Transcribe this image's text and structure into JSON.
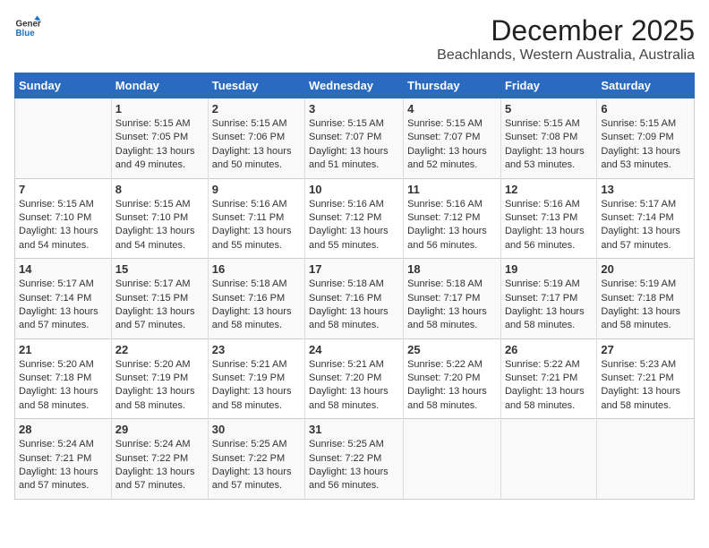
{
  "logo": {
    "general": "General",
    "blue": "Blue"
  },
  "header": {
    "title": "December 2025",
    "subtitle": "Beachlands, Western Australia, Australia"
  },
  "days_of_week": [
    "Sunday",
    "Monday",
    "Tuesday",
    "Wednesday",
    "Thursday",
    "Friday",
    "Saturday"
  ],
  "weeks": [
    [
      {
        "day": "",
        "content": ""
      },
      {
        "day": "1",
        "content": "Sunrise: 5:15 AM\nSunset: 7:05 PM\nDaylight: 13 hours\nand 49 minutes."
      },
      {
        "day": "2",
        "content": "Sunrise: 5:15 AM\nSunset: 7:06 PM\nDaylight: 13 hours\nand 50 minutes."
      },
      {
        "day": "3",
        "content": "Sunrise: 5:15 AM\nSunset: 7:07 PM\nDaylight: 13 hours\nand 51 minutes."
      },
      {
        "day": "4",
        "content": "Sunrise: 5:15 AM\nSunset: 7:07 PM\nDaylight: 13 hours\nand 52 minutes."
      },
      {
        "day": "5",
        "content": "Sunrise: 5:15 AM\nSunset: 7:08 PM\nDaylight: 13 hours\nand 53 minutes."
      },
      {
        "day": "6",
        "content": "Sunrise: 5:15 AM\nSunset: 7:09 PM\nDaylight: 13 hours\nand 53 minutes."
      }
    ],
    [
      {
        "day": "7",
        "content": "Sunrise: 5:15 AM\nSunset: 7:10 PM\nDaylight: 13 hours\nand 54 minutes."
      },
      {
        "day": "8",
        "content": "Sunrise: 5:15 AM\nSunset: 7:10 PM\nDaylight: 13 hours\nand 54 minutes."
      },
      {
        "day": "9",
        "content": "Sunrise: 5:16 AM\nSunset: 7:11 PM\nDaylight: 13 hours\nand 55 minutes."
      },
      {
        "day": "10",
        "content": "Sunrise: 5:16 AM\nSunset: 7:12 PM\nDaylight: 13 hours\nand 55 minutes."
      },
      {
        "day": "11",
        "content": "Sunrise: 5:16 AM\nSunset: 7:12 PM\nDaylight: 13 hours\nand 56 minutes."
      },
      {
        "day": "12",
        "content": "Sunrise: 5:16 AM\nSunset: 7:13 PM\nDaylight: 13 hours\nand 56 minutes."
      },
      {
        "day": "13",
        "content": "Sunrise: 5:17 AM\nSunset: 7:14 PM\nDaylight: 13 hours\nand 57 minutes."
      }
    ],
    [
      {
        "day": "14",
        "content": "Sunrise: 5:17 AM\nSunset: 7:14 PM\nDaylight: 13 hours\nand 57 minutes."
      },
      {
        "day": "15",
        "content": "Sunrise: 5:17 AM\nSunset: 7:15 PM\nDaylight: 13 hours\nand 57 minutes."
      },
      {
        "day": "16",
        "content": "Sunrise: 5:18 AM\nSunset: 7:16 PM\nDaylight: 13 hours\nand 58 minutes."
      },
      {
        "day": "17",
        "content": "Sunrise: 5:18 AM\nSunset: 7:16 PM\nDaylight: 13 hours\nand 58 minutes."
      },
      {
        "day": "18",
        "content": "Sunrise: 5:18 AM\nSunset: 7:17 PM\nDaylight: 13 hours\nand 58 minutes."
      },
      {
        "day": "19",
        "content": "Sunrise: 5:19 AM\nSunset: 7:17 PM\nDaylight: 13 hours\nand 58 minutes."
      },
      {
        "day": "20",
        "content": "Sunrise: 5:19 AM\nSunset: 7:18 PM\nDaylight: 13 hours\nand 58 minutes."
      }
    ],
    [
      {
        "day": "21",
        "content": "Sunrise: 5:20 AM\nSunset: 7:18 PM\nDaylight: 13 hours\nand 58 minutes."
      },
      {
        "day": "22",
        "content": "Sunrise: 5:20 AM\nSunset: 7:19 PM\nDaylight: 13 hours\nand 58 minutes."
      },
      {
        "day": "23",
        "content": "Sunrise: 5:21 AM\nSunset: 7:19 PM\nDaylight: 13 hours\nand 58 minutes."
      },
      {
        "day": "24",
        "content": "Sunrise: 5:21 AM\nSunset: 7:20 PM\nDaylight: 13 hours\nand 58 minutes."
      },
      {
        "day": "25",
        "content": "Sunrise: 5:22 AM\nSunset: 7:20 PM\nDaylight: 13 hours\nand 58 minutes."
      },
      {
        "day": "26",
        "content": "Sunrise: 5:22 AM\nSunset: 7:21 PM\nDaylight: 13 hours\nand 58 minutes."
      },
      {
        "day": "27",
        "content": "Sunrise: 5:23 AM\nSunset: 7:21 PM\nDaylight: 13 hours\nand 58 minutes."
      }
    ],
    [
      {
        "day": "28",
        "content": "Sunrise: 5:24 AM\nSunset: 7:21 PM\nDaylight: 13 hours\nand 57 minutes."
      },
      {
        "day": "29",
        "content": "Sunrise: 5:24 AM\nSunset: 7:22 PM\nDaylight: 13 hours\nand 57 minutes."
      },
      {
        "day": "30",
        "content": "Sunrise: 5:25 AM\nSunset: 7:22 PM\nDaylight: 13 hours\nand 57 minutes."
      },
      {
        "day": "31",
        "content": "Sunrise: 5:25 AM\nSunset: 7:22 PM\nDaylight: 13 hours\nand 56 minutes."
      },
      {
        "day": "",
        "content": ""
      },
      {
        "day": "",
        "content": ""
      },
      {
        "day": "",
        "content": ""
      }
    ]
  ]
}
